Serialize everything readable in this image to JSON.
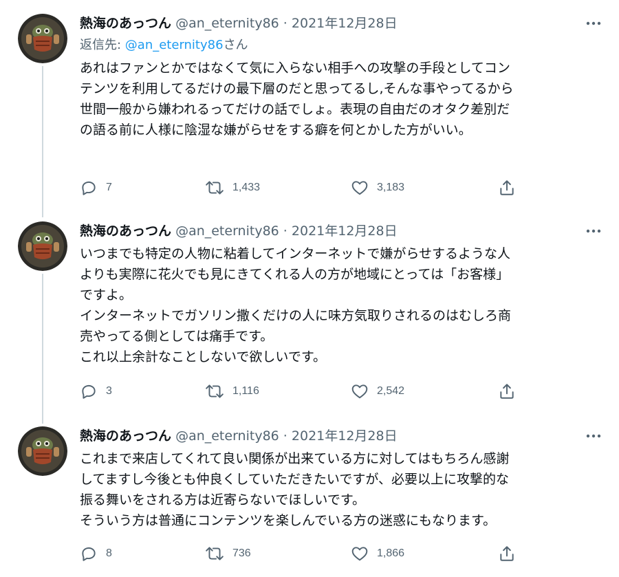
{
  "tweets": [
    {
      "name": "熱海のあっつん",
      "handle": "@an_eternity86",
      "sep": "·",
      "date": "2021年12月28日",
      "reply_prefix": "返信先: ",
      "reply_mention": "@an_eternity86",
      "reply_suffix": "さん",
      "lines": [
        "あれはファンとかではなくて気に入らない相手への攻撃の手段としてコン",
        "テンツを利用してるだけの最下層のだと思ってるし,そんな事やってるから",
        "世間一般から嫌われるってだけの話でしょ。表現の自由だのオタク差別だ",
        "の語る前に人様に陰湿な嫌がらせをする癖を何とかした方がいい。"
      ],
      "replies": "7",
      "retweets": "1,433",
      "likes": "3,183"
    },
    {
      "name": "熱海のあっつん",
      "handle": "@an_eternity86",
      "sep": "·",
      "date": "2021年12月28日",
      "lines": [
        "いつまでも特定の人物に粘着してインターネットで嫌がらせするような人",
        "よりも実際に花火でも見にきてくれる人の方が地域にとっては「お客様」",
        "ですよ。",
        "インターネットでガソリン撒くだけの人に味方気取りされるのはむしろ商",
        "売やってる側としては痛手です。",
        "これ以上余計なことしないで欲しいです。"
      ],
      "replies": "3",
      "retweets": "1,116",
      "likes": "2,542"
    },
    {
      "name": "熱海のあっつん",
      "handle": "@an_eternity86",
      "sep": "·",
      "date": "2021年12月28日",
      "lines": [
        "これまで来店してくれて良い関係が出来ている方に対してはもちろん感謝",
        "してますし今後とも仲良くしていただきたいですが、必要以上に攻撃的な",
        "振る舞いをされる方は近寄らないでほしいです。",
        "そういう方は普通にコンテンツを楽しんでいる方の迷惑にもなります。"
      ],
      "replies": "8",
      "retweets": "736",
      "likes": "1,866"
    }
  ],
  "icons": {
    "reply": "reply-icon",
    "retweet": "retweet-icon",
    "like": "heart-icon",
    "share": "share-icon",
    "more": "more-icon"
  },
  "colors": {
    "text": "#0f1419",
    "secondary": "#536471",
    "link": "#1d9bf0",
    "thread_line": "#cfd9de"
  }
}
